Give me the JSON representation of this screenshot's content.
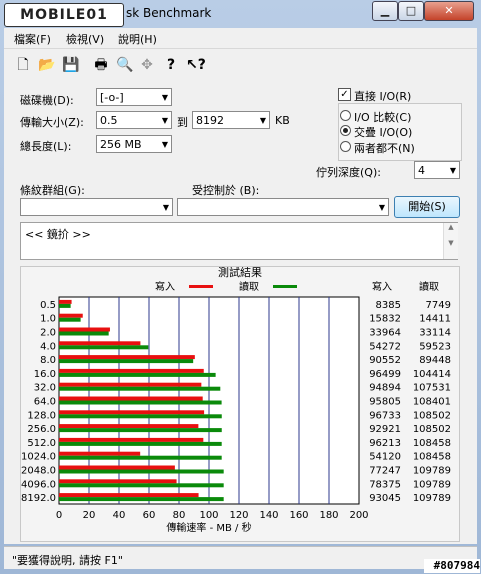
{
  "window": {
    "logo_text": "MOBILE01",
    "title": "sk Benchmark"
  },
  "window_buttons": {
    "minimize": "▁",
    "maximize": "□",
    "close": "✕"
  },
  "menu": [
    "檔案(F)",
    "檢視(V)",
    "說明(H)"
  ],
  "toolbar_icons": [
    "new-file-icon",
    "open-folder-icon",
    "save-icon",
    "print-icon",
    "print-preview-icon",
    "move-icon",
    "help-icon",
    "context-help-icon"
  ],
  "form": {
    "drive_label": "磁碟機(D):",
    "drive_value": "[-o-]",
    "transfer_label": "傳輸大小(Z):",
    "transfer_from": "0.5",
    "to_label": "到",
    "transfer_to": "8192",
    "unit": "KB",
    "total_label": "總長度(L):",
    "total_value": "256 MB",
    "direct_io_label": "直接 I/O(R)",
    "direct_io_checked": true,
    "io_options": [
      "I/O 比較(C)",
      "交疊 I/O(O)",
      "兩者都不(N)"
    ],
    "io_selected": 1,
    "queue_label": "佇列深度(Q):",
    "queue_value": "4",
    "pattern_label": "條紋群組(G):",
    "pattern_value": "",
    "controlled_label": "受控制於 (B):",
    "controlled_value": "",
    "start_button": "開始(S)",
    "description": "<< 鏡扴 >>"
  },
  "status": {
    "text": "\"要獲得說明, 請按 F1\"",
    "watermark": "#807984"
  },
  "chart_data": {
    "type": "bar",
    "orientation": "horizontal",
    "title": "測試結果",
    "xlabel": "傳輸速率 - MB / 秒",
    "xlim": [
      0,
      200
    ],
    "xticks": [
      0,
      20,
      40,
      60,
      80,
      100,
      120,
      140,
      160,
      180,
      200
    ],
    "grid": true,
    "legend_position": "top",
    "colors": {
      "write": "#e81010",
      "read": "#0a8a0a"
    },
    "column_headers": {
      "write": "寫入",
      "read": "讀取"
    },
    "categories": [
      "0.5",
      "1.0",
      "2.0",
      "4.0",
      "8.0",
      "16.0",
      "32.0",
      "64.0",
      "128.0",
      "256.0",
      "512.0",
      "1024.0",
      "2048.0",
      "4096.0",
      "8192.0"
    ],
    "series": [
      {
        "name": "寫入",
        "values": [
          8385,
          15832,
          33964,
          54272,
          90552,
          96499,
          94894,
          95805,
          96733,
          92921,
          96213,
          54120,
          77247,
          78375,
          93045
        ]
      },
      {
        "name": "讀取",
        "values": [
          7749,
          14411,
          33114,
          59523,
          89448,
          104414,
          107531,
          108401,
          108502,
          108502,
          108458,
          108458,
          109789,
          109789,
          109789
        ]
      }
    ]
  }
}
